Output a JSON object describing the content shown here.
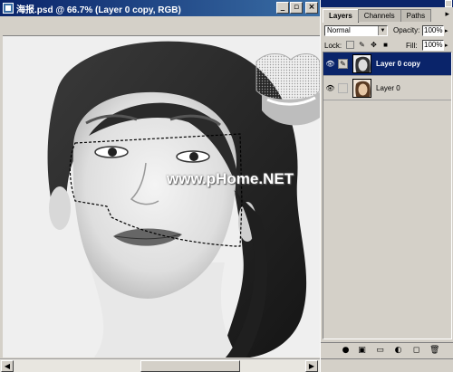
{
  "document": {
    "title": "海报.psd @ 66.7% (Layer 0 copy, RGB)",
    "watermark": "www.pHome.NET",
    "buttons": {
      "minimize": "_",
      "restore": "▫",
      "close": "×"
    }
  },
  "palette": {
    "tabs": [
      {
        "label": "Layers"
      },
      {
        "label": "Channels"
      },
      {
        "label": "Paths"
      }
    ],
    "menu_arrow": "▸",
    "blend_mode": "Normal",
    "opacity_label": "Opacity:",
    "opacity_value": "100%",
    "lock_label": "Lock:",
    "fill_label": "Fill:",
    "fill_value": "100%",
    "layers": [
      {
        "name": "Layer 0 copy",
        "selected": true,
        "visible": true
      },
      {
        "name": "Layer 0",
        "selected": false,
        "visible": true
      }
    ],
    "bottom_icons": [
      "layer-style-icon",
      "mask-icon",
      "new-set-icon",
      "adjustment-layer-icon",
      "new-layer-icon",
      "trash-icon"
    ]
  },
  "colors": {
    "title_active": "#0a246a",
    "selection_bg": "#0a246a",
    "panel_bg": "#d4d0c8"
  }
}
